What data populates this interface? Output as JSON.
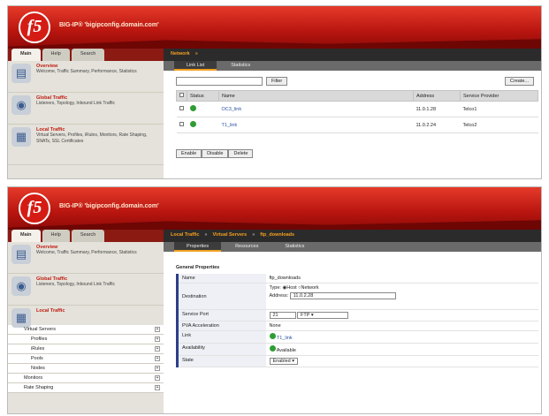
{
  "screen1": {
    "hostname": "BIG-IP® 'bigipconfig.domain.com'",
    "tabs": [
      "Main",
      "Help",
      "Search"
    ],
    "nav": [
      {
        "title": "Overview",
        "desc": "Welcome, Traffic Summary, Performance, Statistics",
        "icon": "overview-icon"
      },
      {
        "title": "Global Traffic",
        "desc": "Listeners, Topology, Inbound Link Traffic",
        "icon": "globe-icon"
      },
      {
        "title": "Local Traffic",
        "desc": "Virtual Servers, Profiles, iRules, Monitors, Rate Shaping, SNATs, SSL Certificates",
        "icon": "server-icon"
      }
    ],
    "breadcrumb": "Network",
    "subtabs": [
      "Link List",
      "Statistics"
    ],
    "filter_button": "Filter",
    "create_button": "Create...",
    "columns": [
      "Status",
      "Name",
      "Address",
      "Service Provider"
    ],
    "rows": [
      {
        "name": "OC3_link",
        "address": "11.0.1.28",
        "provider": "Telco1"
      },
      {
        "name": "T1_link",
        "address": "11.0.2.24",
        "provider": "Telco2"
      }
    ],
    "actions": [
      "Enable",
      "Disable",
      "Delete"
    ]
  },
  "screen2": {
    "hostname": "BIG-IP® 'bigipconfig.domain.com'",
    "tabs": [
      "Main",
      "Help",
      "Search"
    ],
    "nav": [
      {
        "title": "Overview",
        "desc": "Welcome, Traffic Summary, Performance, Statistics",
        "icon": "overview-icon"
      },
      {
        "title": "Global Traffic",
        "desc": "Listeners, Topology, Inbound Link Traffic",
        "icon": "globe-icon"
      },
      {
        "title": "Local Traffic",
        "desc": "",
        "icon": "server-icon"
      }
    ],
    "subnav": [
      "Virtual Servers",
      "Profiles",
      "iRules",
      "Pools",
      "Nodes",
      "Monitors",
      "Rate Shaping"
    ],
    "breadcrumb": [
      "Local Traffic",
      "Virtual Servers",
      "ftp_downloads"
    ],
    "subtabs": [
      "Properties",
      "Resources",
      "Statistics"
    ],
    "section": "General Properties",
    "props": {
      "name_label": "Name",
      "name_value": "ftp_downloads",
      "dest_label": "Destination",
      "type_label": "Type:",
      "host_opt": "Host",
      "network_opt": "Network",
      "addr_label": "Address:",
      "addr_value": "11.0.2.28",
      "port_label": "Service Port",
      "port_value": "21",
      "port_proto": "FTP",
      "pva_label": "PVA Acceleration",
      "pva_value": "None",
      "link_label": "Link",
      "link_value": "T1_link",
      "avail_label": "Availability",
      "avail_value": "Available",
      "state_label": "State",
      "state_value": "Enabled"
    }
  },
  "colors": {
    "brand_red": "#d41c15",
    "nav_title": "#c01a10",
    "status_green": "#2f9d34",
    "link_blue": "#2b52a3",
    "tab_accent": "#f0a020"
  }
}
